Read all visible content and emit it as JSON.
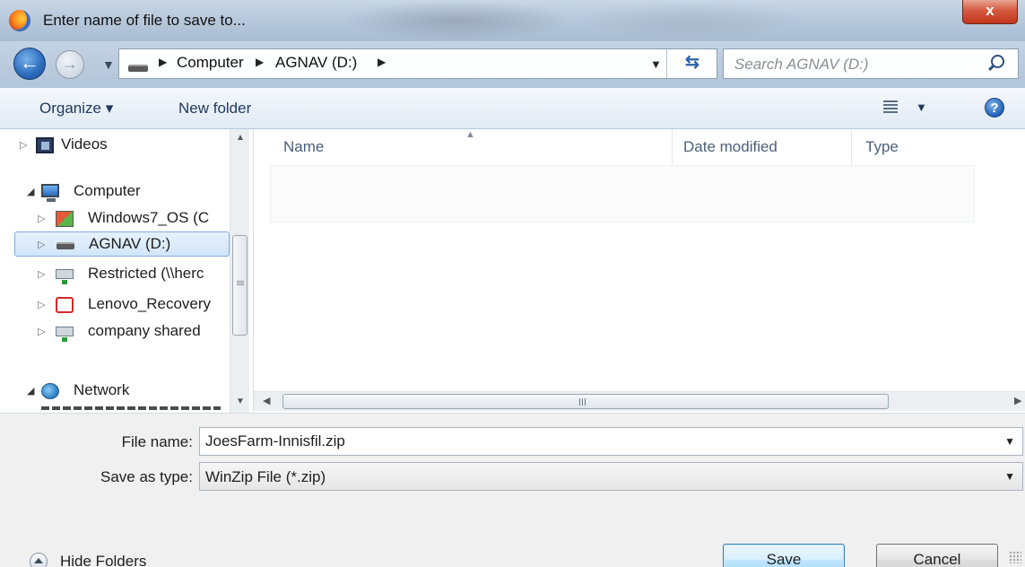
{
  "window": {
    "title": "Enter name of file to save to...",
    "close_label": "x"
  },
  "address": {
    "crumbs": [
      "Computer",
      "AGNAV (D:)"
    ],
    "search_placeholder": "Search AGNAV (D:)"
  },
  "toolbar": {
    "organize_label": "Organize ▾",
    "new_folder_label": "New folder",
    "help_label": "?"
  },
  "nav": {
    "items": [
      {
        "label": "Videos",
        "icon": "videos-icon"
      },
      {
        "label": "Computer",
        "icon": "computer-icon"
      },
      {
        "label": "Windows7_OS (C",
        "icon": "windows-drive-icon"
      },
      {
        "label": "AGNAV (D:)",
        "icon": "drive-icon"
      },
      {
        "label": "Restricted (\\\\herc",
        "icon": "network-drive-icon"
      },
      {
        "label": "Lenovo_Recovery",
        "icon": "recovery-drive-icon"
      },
      {
        "label": "company shared",
        "icon": "network-drive-icon"
      },
      {
        "label": "Network",
        "icon": "network-icon"
      }
    ]
  },
  "file_list": {
    "columns": [
      "Name",
      "Date modified",
      "Type"
    ]
  },
  "form": {
    "file_name_label": "File name:",
    "file_name_value": "JoesFarm-Innisfil.zip",
    "save_type_label": "Save as type:",
    "save_type_value": "WinZip File (*.zip)"
  },
  "footer": {
    "hide_folders_label": "Hide Folders",
    "save_label": "Save",
    "cancel_label": "Cancel"
  }
}
